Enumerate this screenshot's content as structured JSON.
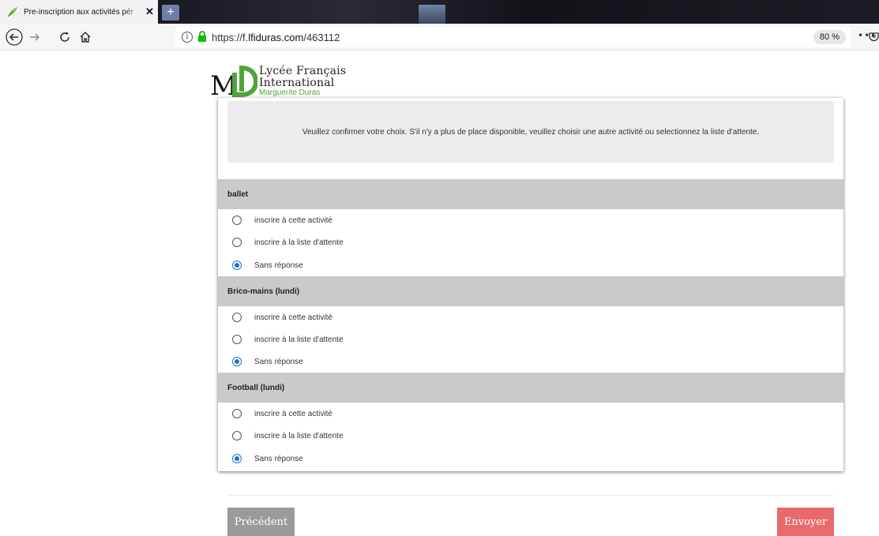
{
  "browser": {
    "tab_title": "Pre-inscription aux activités pér",
    "tab_close": "✕",
    "newtab": "+",
    "url_prefix": "https://f.",
    "url_domain": "lfiduras.com",
    "url_path": "/463112",
    "zoom": "80 %",
    "more": "•••"
  },
  "logo": {
    "mark": "ML",
    "line1": "Lycée Français",
    "line2": "International",
    "line3": "Marguerite Duras",
    "brand_green": "#4fa53a"
  },
  "notice": "Veuillez confirmer votre choix. S'il n'y a plus de place disponible, veuillez choisir une autre activité ou selectionnez la liste d'attente.",
  "activities": [
    {
      "name": "ballet",
      "options": [
        {
          "label": "inscrire à cette activité",
          "checked": false
        },
        {
          "label": "inscrire à la liste d'attente",
          "checked": false
        },
        {
          "label": "Sans réponse",
          "checked": true
        }
      ]
    },
    {
      "name": "Brico-mains (lundi)",
      "options": [
        {
          "label": "inscrire à cette activité",
          "checked": false
        },
        {
          "label": "inscrire à la liste d'attente",
          "checked": false
        },
        {
          "label": "Sans réponse",
          "checked": true
        }
      ]
    },
    {
      "name": "Football (lundi)",
      "options": [
        {
          "label": "inscrire à cette activité",
          "checked": false
        },
        {
          "label": "inscrire à la liste d'attente",
          "checked": false
        },
        {
          "label": "Sans réponse",
          "checked": true
        }
      ]
    }
  ],
  "buttons": {
    "prev": "Précédent",
    "send": "Envoyer"
  },
  "colors": {
    "send_button": "#e86b6b",
    "prev_button": "#9a9a9a",
    "section_header": "#cacaca",
    "radio_checked": "#1f6fd1"
  }
}
